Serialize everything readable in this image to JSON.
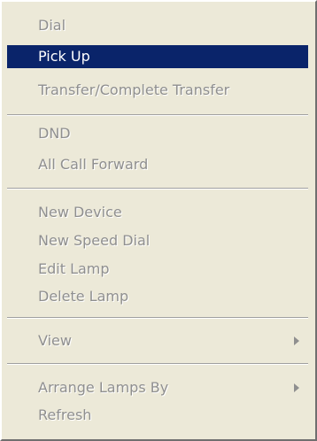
{
  "menu": {
    "items": [
      {
        "label": "Dial",
        "enabled": false
      },
      {
        "label": "Pick Up",
        "enabled": true,
        "selected": true
      },
      {
        "label": "Transfer/Complete Transfer",
        "enabled": false
      },
      {
        "label": "DND",
        "enabled": false
      },
      {
        "label": "All Call Forward",
        "enabled": false
      },
      {
        "label": "New Device",
        "enabled": false
      },
      {
        "label": "New Speed Dial",
        "enabled": false
      },
      {
        "label": "Edit Lamp",
        "enabled": false
      },
      {
        "label": "Delete Lamp",
        "enabled": false
      },
      {
        "label": "View",
        "enabled": false,
        "submenu": true
      },
      {
        "label": "Arrange Lamps By",
        "enabled": false,
        "submenu": true
      },
      {
        "label": "Refresh",
        "enabled": false
      }
    ]
  },
  "colors": {
    "menu_background": "#ece9d8",
    "highlight": "#0a246a",
    "disabled_text": "#8f8f8f"
  },
  "icons": {
    "submenu_arrow": "right-triangle"
  }
}
